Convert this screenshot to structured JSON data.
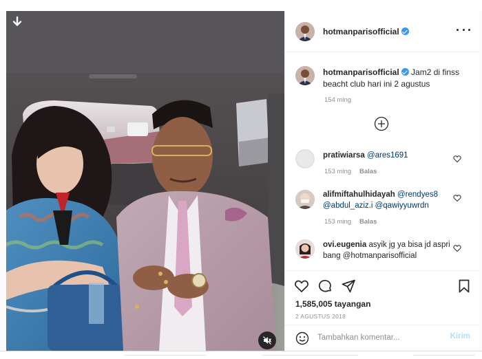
{
  "post": {
    "username": "hotmanparisofficial",
    "caption_user": "hotmanparisofficial",
    "caption_text": "Jam2 di finss beacht club hari ini 2 agustus",
    "caption_time": "154 ming",
    "views": "1,585,005 tayangan",
    "date": "2 AGUSTUS 2018"
  },
  "comments": [
    {
      "user": "pratiwiarsa",
      "text": "@ares1691",
      "time": "153 ming",
      "reply": "Balas"
    },
    {
      "user": "alifmiftahulhidayah",
      "text": "@rendyes8 @abdul_aziz.i @qawiyyuwrdn",
      "time": "153 ming",
      "reply": "Balas"
    },
    {
      "user": "ovi.eugenia",
      "text": "asyik jg ya bisa jd aspri bang @hotmanparisofficial"
    }
  ],
  "comment_box": {
    "placeholder": "Tambahkan komentar...",
    "post_label": "Kirim"
  },
  "icons": {
    "download": "download-arrow-icon",
    "more": "more-options-icon",
    "add_comments": "plus-circle-icon",
    "like": "heart-icon",
    "comment": "comment-bubble-icon",
    "share": "paper-plane-icon",
    "save": "bookmark-icon",
    "emoji": "emoji-icon",
    "mute": "muted-speaker-icon",
    "verified": "verified-badge-icon"
  },
  "colors": {
    "verified": "#3897f0",
    "link": "#00376b",
    "muted": "#8e8e8e",
    "post_disabled": "#b2dffc"
  }
}
